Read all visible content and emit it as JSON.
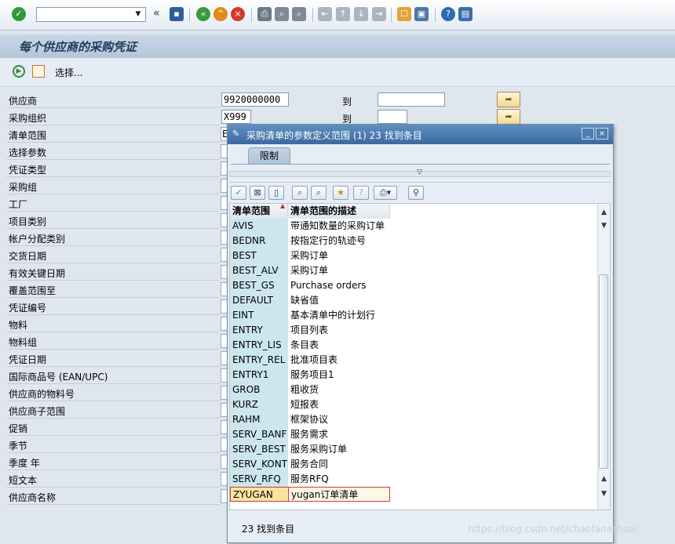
{
  "toolbar": {
    "command_field_value": "",
    "nav_back_glyph": "«"
  },
  "page": {
    "title": "每个供应商的采购凭证",
    "app_toolbar": {
      "select_label": "选择..."
    }
  },
  "form": {
    "to_label": "到",
    "fields": [
      {
        "label": "供应商",
        "value": "9920000000"
      },
      {
        "label": "采购组织",
        "value": "X999"
      },
      {
        "label": "清单范围",
        "value": "E"
      },
      {
        "label": "选择参数",
        "value": ""
      },
      {
        "label": "凭证类型",
        "value": ""
      },
      {
        "label": "采购组",
        "value": ""
      },
      {
        "label": "工厂",
        "value": ""
      },
      {
        "label": "项目类别",
        "value": ""
      },
      {
        "label": "帐户分配类别",
        "value": ""
      },
      {
        "label": "交货日期",
        "value": ""
      },
      {
        "label": "有效关键日期",
        "value": ""
      },
      {
        "label": "覆盖范围至",
        "value": ""
      },
      {
        "label": "凭证编号",
        "value": ""
      },
      {
        "label": "物料",
        "value": ""
      },
      {
        "label": "物料组",
        "value": ""
      },
      {
        "label": "凭证日期",
        "value": ""
      },
      {
        "label": "国际商品号 (EAN/UPC)",
        "value": ""
      },
      {
        "label": "供应商的物料号",
        "value": ""
      },
      {
        "label": "供应商子范围",
        "value": ""
      },
      {
        "label": "促销",
        "value": ""
      },
      {
        "label": "季节",
        "value": ""
      },
      {
        "label": "季度 年",
        "value": ""
      },
      {
        "label": "短文本",
        "value": ""
      },
      {
        "label": "供应商名称",
        "value": ""
      }
    ]
  },
  "dialog": {
    "title": "采购清单的参数定义范围 (1)   23 找到条目",
    "tab_label": "限制",
    "columns": [
      "清单范围",
      "清单范围的描述"
    ],
    "rows": [
      {
        "code": "AVIS",
        "desc": "带通知数量的采购订单"
      },
      {
        "code": "BEDNR",
        "desc": "按指定行的轨迹号"
      },
      {
        "code": "BEST",
        "desc": "采购订单"
      },
      {
        "code": "BEST_ALV",
        "desc": "采购订单"
      },
      {
        "code": "BEST_GS",
        "desc": "Purchase orders"
      },
      {
        "code": "DEFAULT",
        "desc": "缺省值"
      },
      {
        "code": "EINT",
        "desc": "基本清单中的计划行"
      },
      {
        "code": "ENTRY",
        "desc": "项目列表"
      },
      {
        "code": "ENTRY_LIS",
        "desc": "条目表"
      },
      {
        "code": "ENTRY_REL",
        "desc": "批准项目表"
      },
      {
        "code": "ENTRY1",
        "desc": "服务项目1"
      },
      {
        "code": "GROB",
        "desc": "粗收货"
      },
      {
        "code": "KURZ",
        "desc": "短报表"
      },
      {
        "code": "RAHM",
        "desc": "框架协议"
      },
      {
        "code": "SERV_BANF",
        "desc": "服务需求"
      },
      {
        "code": "SERV_BEST",
        "desc": "服务采购订单"
      },
      {
        "code": "SERV_KONT",
        "desc": "服务合同"
      },
      {
        "code": "SERV_RFQ",
        "desc": "服务RFQ"
      },
      {
        "code": "ZYUGAN",
        "desc": "yugan订单清单"
      }
    ],
    "selected_code": "ZYUGAN",
    "status": "23 找到条目"
  },
  "watermark": "https://blog.csdn.net/chaofanashuai",
  "colors": {
    "title_text": "#1d3a5c",
    "dialog_title_bg": "#3c6a9f",
    "code_column_bg": "#cce6ee",
    "selection_border": "#d23a3a"
  }
}
